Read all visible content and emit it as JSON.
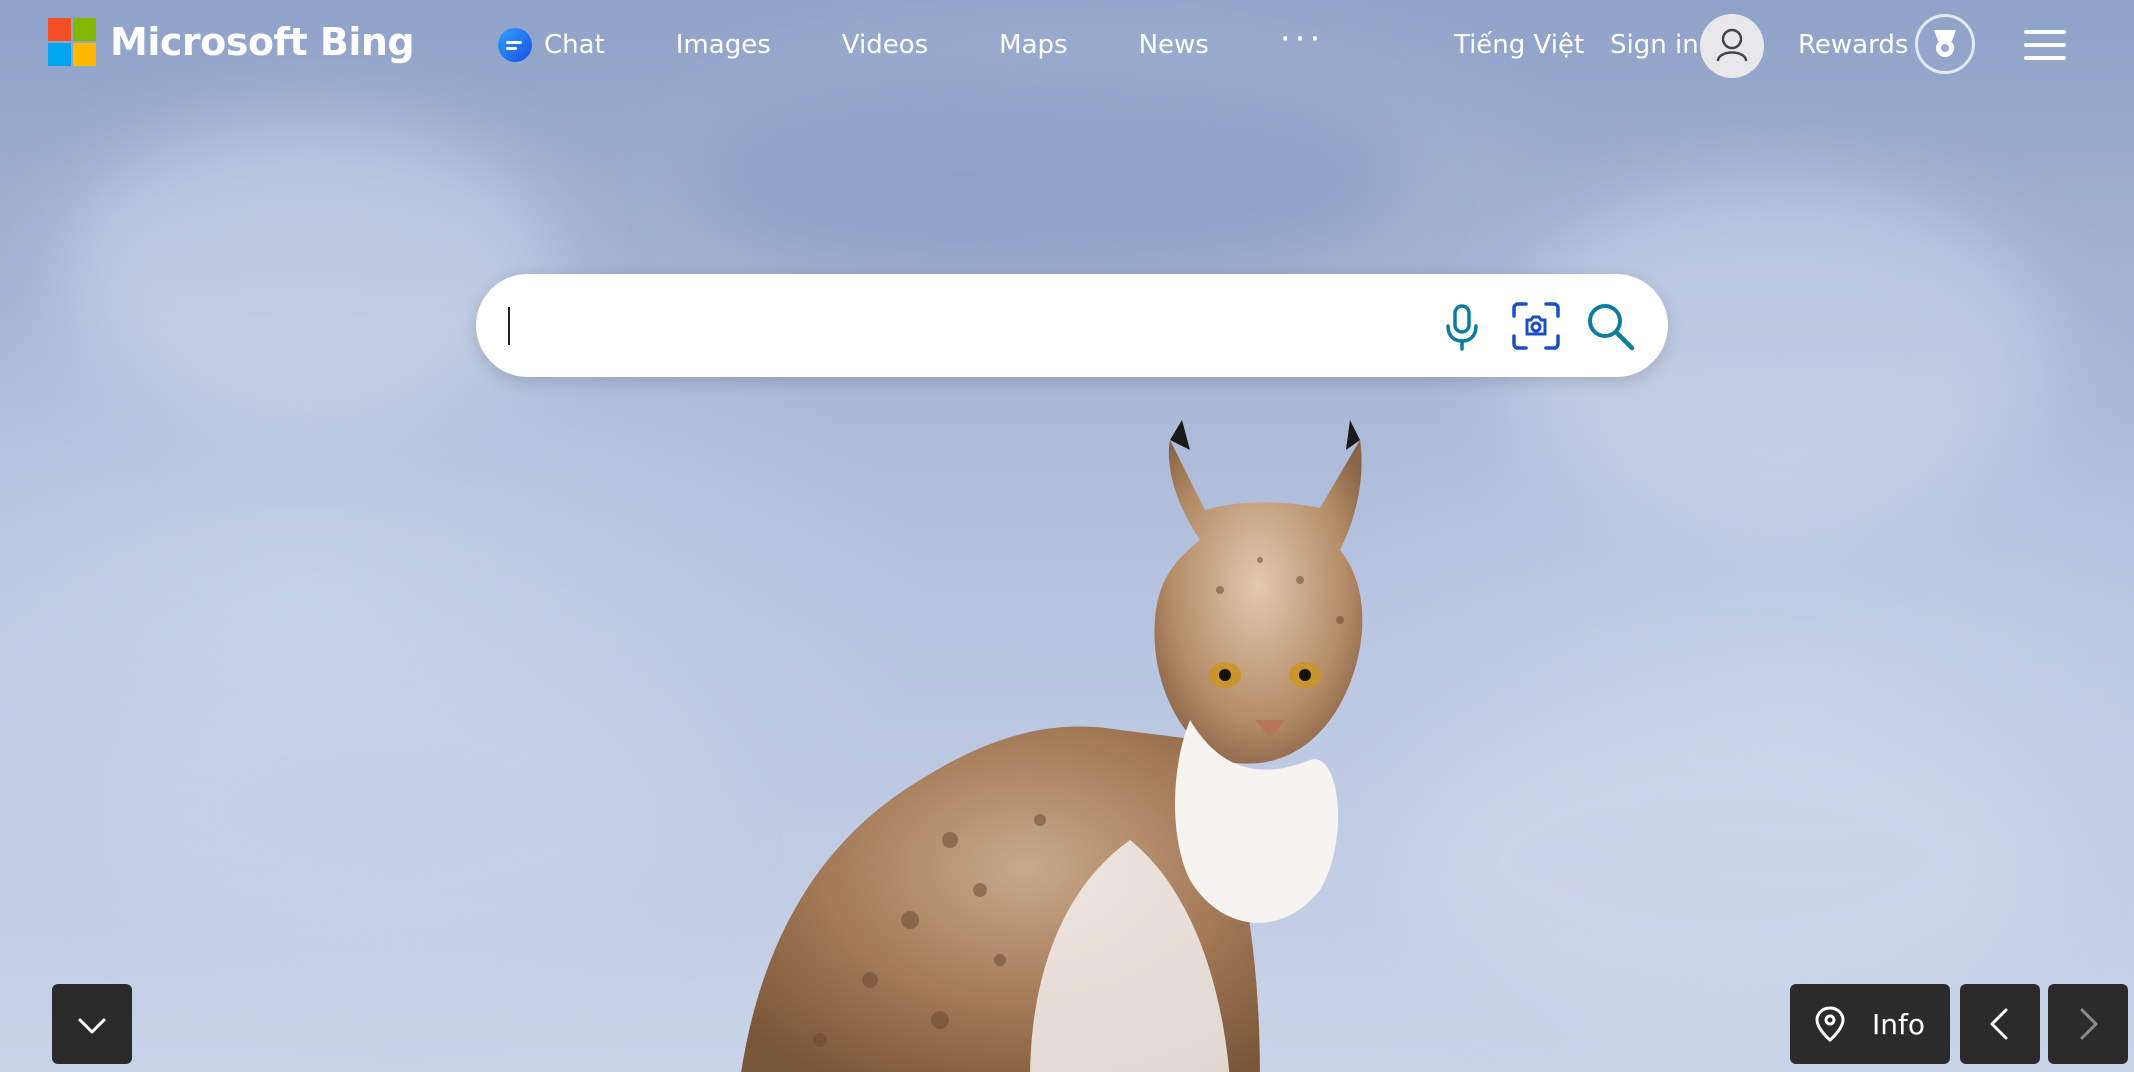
{
  "brand": {
    "name": "Microsoft Bing",
    "logo_colors": [
      "#f25022",
      "#7fba00",
      "#00a4ef",
      "#ffb900"
    ]
  },
  "nav": {
    "items": [
      {
        "label": "Chat",
        "icon": "chat-bubble-icon"
      },
      {
        "label": "Images"
      },
      {
        "label": "Videos"
      },
      {
        "label": "Maps"
      },
      {
        "label": "News"
      }
    ],
    "more_label": "···"
  },
  "account": {
    "language_label": "Tiếng Việt",
    "signin_label": "Sign in",
    "avatar_icon": "person-icon",
    "rewards_label": "Rewards",
    "rewards_icon": "medal-icon",
    "menu_icon": "hamburger-menu-icon"
  },
  "search": {
    "value": "",
    "placeholder": "",
    "voice_icon": "microphone-icon",
    "visual_icon": "visual-search-camera-icon",
    "submit_icon": "search-icon",
    "icon_color": "#0c7d9d"
  },
  "background": {
    "subject": "lynx in snow"
  },
  "footer": {
    "scroll_icon": "chevron-down-icon",
    "info_label": "Info",
    "info_icon": "location-pin-icon",
    "prev_icon": "chevron-left-icon",
    "next_icon": "chevron-right-icon"
  }
}
